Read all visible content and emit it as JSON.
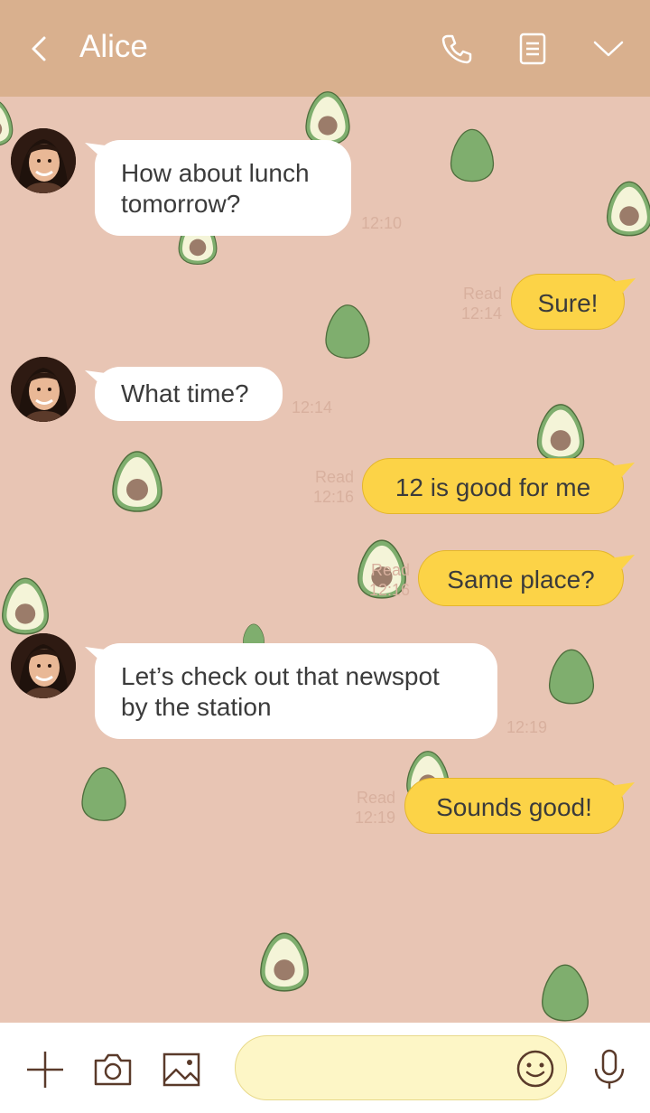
{
  "header": {
    "title": "Alice",
    "icons": [
      "back-icon",
      "phone-icon",
      "notes-icon",
      "chevron-down-icon"
    ]
  },
  "messages": [
    {
      "side": "in",
      "text_lines": [
        "How about lunch",
        "tomorrow?"
      ],
      "time": "12:10"
    },
    {
      "side": "out",
      "text": "Sure!",
      "read": "Read",
      "time": "12:14"
    },
    {
      "side": "in",
      "text_lines": [
        "What time?"
      ],
      "time": "12:14"
    },
    {
      "side": "out",
      "text": "12 is good for me",
      "read": "Read",
      "time": "12:16"
    },
    {
      "side": "out",
      "text": "Same place?",
      "read": "Read",
      "time": "12:16"
    },
    {
      "side": "in",
      "text_lines": [
        "Let’s check out that newspot",
        "by the station"
      ],
      "time": "12:19"
    },
    {
      "side": "out",
      "text": "Sounds good!",
      "read": "Read",
      "time": "12:19"
    }
  ],
  "composer": {
    "placeholder": "",
    "icons": [
      "plus-icon",
      "camera-icon",
      "image-icon",
      "emoji-icon",
      "microphone-icon"
    ]
  },
  "colors": {
    "background": "#e8c5b4",
    "header": "#d9b08e",
    "outgoing_bubble": "#fcd347",
    "incoming_bubble": "#ffffff",
    "input_field": "#fdf6c6",
    "avocado_skin": "#7fae6e",
    "avocado_flesh": "#f4f4d8",
    "avocado_pit": "#9b7c6a"
  }
}
